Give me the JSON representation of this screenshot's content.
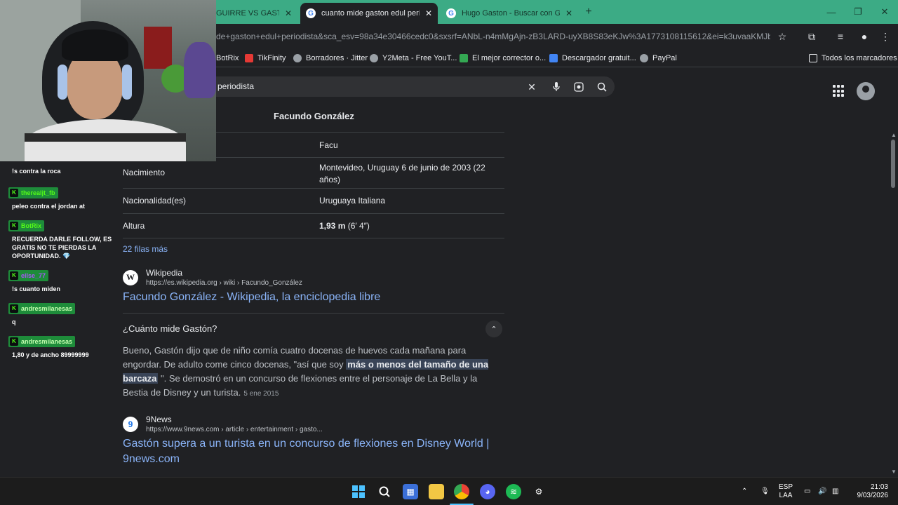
{
  "browser": {
    "tabs": [
      {
        "title": "GUIRRE VS GASTÓN"
      },
      {
        "title": "cuanto mide gaston edul periodista"
      },
      {
        "title": "Hugo Gaston - Buscar con Google"
      }
    ],
    "new_tab": "+",
    "url": "de+gaston+edul+periodista&sca_esv=98a34e30466cedc0&sxsrf=ANbL-n4mMgAjn-zB3LARD-uyXB8S83eKJw%3A1773108115612&ei=k3uvaaKMJbPX1...",
    "bookmarks": [
      {
        "label": "BotRix",
        "color": "#3cab85"
      },
      {
        "label": "TikFinity",
        "color": "#e53935"
      },
      {
        "label": "Borradores · Jitter",
        "color": "#9aa0a6"
      },
      {
        "label": "Y2Meta - Free YouT...",
        "color": "#9aa0a6"
      },
      {
        "label": "El mejor corrector o...",
        "color": "#34a853"
      },
      {
        "label": "Descargador gratuit...",
        "color": "#4285f4"
      },
      {
        "label": "PayPal",
        "color": "#9aa0a6"
      }
    ],
    "all_bookmarks": "Todos los marcadores"
  },
  "search": {
    "query_visible": "periodista"
  },
  "infobox": {
    "header": "Facundo González",
    "rows": [
      {
        "key": "",
        "value": "Facu"
      },
      {
        "key": "Nacimiento",
        "value": "Montevideo, Uruguay 6 de junio de 2003 (22 años)"
      },
      {
        "key": "Nacionalidad(es)",
        "value": "Uruguaya Italiana"
      },
      {
        "key": "Altura",
        "value_bold": "1,93 m",
        "value_rest": " (6′ 4″)"
      }
    ],
    "more": "22 filas más"
  },
  "result_wiki": {
    "source": "Wikipedia",
    "logo": "W",
    "url": "https://es.wikipedia.org › wiki › Facundo_González",
    "title": "Facundo González - Wikipedia, la enciclopedia libre"
  },
  "faq": {
    "question": "¿Cuánto mide Gastón?",
    "answer_pre": "Bueno, Gastón dijo que de niño comía cuatro docenas de huevos cada mañana para engordar. De adulto come cinco docenas, \"así que soy ",
    "answer_highlight": "más o menos del tamaño de una barcaza",
    "answer_post": " \". Se demostró en un concurso de flexiones entre el personaje de La Bella y la Bestia de Disney y un turista.",
    "date": "5 ene 2015"
  },
  "result_9news": {
    "source": "9News",
    "logo": "9",
    "url": "https://www.9news.com › article › entertainment › gasto...",
    "title": "Gastón supera a un turista en un concurso de flexiones en Disney World | 9news.com"
  },
  "chat": [
    {
      "user": "",
      "text": "!s contra la roca"
    },
    {
      "user": "therealjt_fb",
      "text": "peleo contra el jordan at"
    },
    {
      "user": "BotRix",
      "text": "RECUERDA DARLE FOLLOW, ES GRATIS NO TE PIERDAS LA OPORTUNIDAD. 💎"
    },
    {
      "user": "eilse_77",
      "text": "!s cuanto miden"
    },
    {
      "user": "andresmilanesas",
      "text": "q"
    },
    {
      "user": "andresmilanesas",
      "text": "1,80 y de ancho 89999999"
    }
  ],
  "taskbar": {
    "lang": "ESP",
    "lang2": "LAA",
    "time": "21:03",
    "date": "9/03/2026"
  },
  "colors": {
    "tabstrip": "#3cab85",
    "link": "#8ab4f8",
    "kick_green": "#53fc18"
  }
}
